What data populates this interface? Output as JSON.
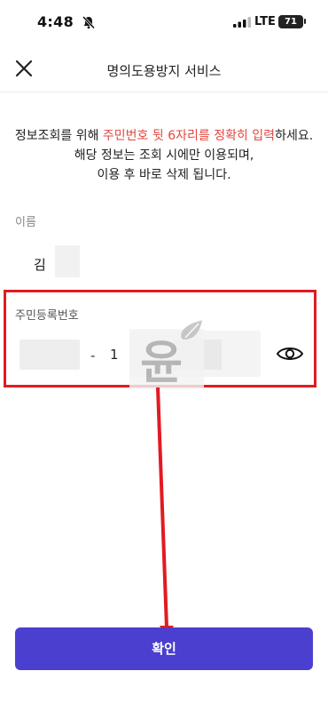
{
  "status_bar": {
    "time": "4:48",
    "network": "LTE",
    "battery": "71"
  },
  "nav": {
    "title": "명의도용방지 서비스"
  },
  "intro": {
    "line1_a": "정보조회를 위해 ",
    "line1_highlight": "주민번호 뒷 6자리를 정확히 입력",
    "line1_b": "하세요.",
    "line2": "해당 정보는 조회 시에만 이용되며,",
    "line3": "이용 후 바로 삭제 됩니다."
  },
  "form": {
    "name_label": "이름",
    "name_value": "김",
    "rrn_label": "주민등록번호",
    "rrn_dash": "-",
    "rrn_back_first_digit": "1"
  },
  "watermark": {
    "text": "윤"
  },
  "footer": {
    "confirm_label": "확인"
  },
  "colors": {
    "accent": "#4a3fcf",
    "highlight_text": "#e3463e",
    "annotation_red": "#e11b22"
  }
}
